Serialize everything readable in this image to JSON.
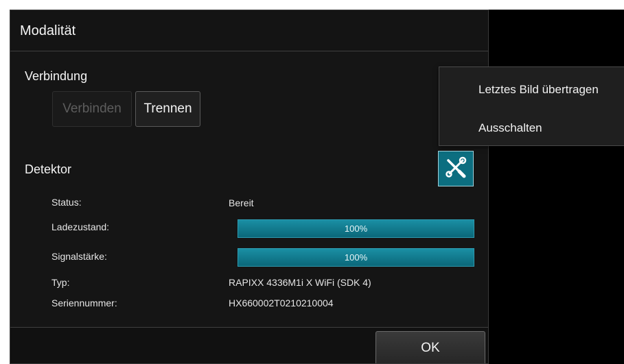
{
  "dialog": {
    "title": "Modalität"
  },
  "connection": {
    "heading": "Verbindung",
    "connect_label": "Verbinden",
    "disconnect_label": "Trennen"
  },
  "detector": {
    "heading": "Detektor",
    "fields": {
      "status": {
        "label": "Status:",
        "value": "Bereit"
      },
      "charge": {
        "label": "Ladezustand:",
        "value": "100%",
        "fraction": 1.0
      },
      "signal": {
        "label": "Signalstärke:",
        "value": "100%",
        "fraction": 1.0
      },
      "type": {
        "label": "Typ:",
        "value": "RAPIXX 4336M1i X WiFi (SDK 4)"
      },
      "serial": {
        "label": "Seriennummer:",
        "value": "HX660002T0210210004"
      }
    },
    "tools_icon": "tools-icon"
  },
  "footer": {
    "ok_label": "OK"
  },
  "context_menu": {
    "items": [
      {
        "label": "Letztes Bild übertragen"
      },
      {
        "label": "Ausschalten"
      }
    ]
  },
  "colors": {
    "accent": "#0c6e80",
    "progress": "#1a8fa4",
    "background": "#151515"
  }
}
